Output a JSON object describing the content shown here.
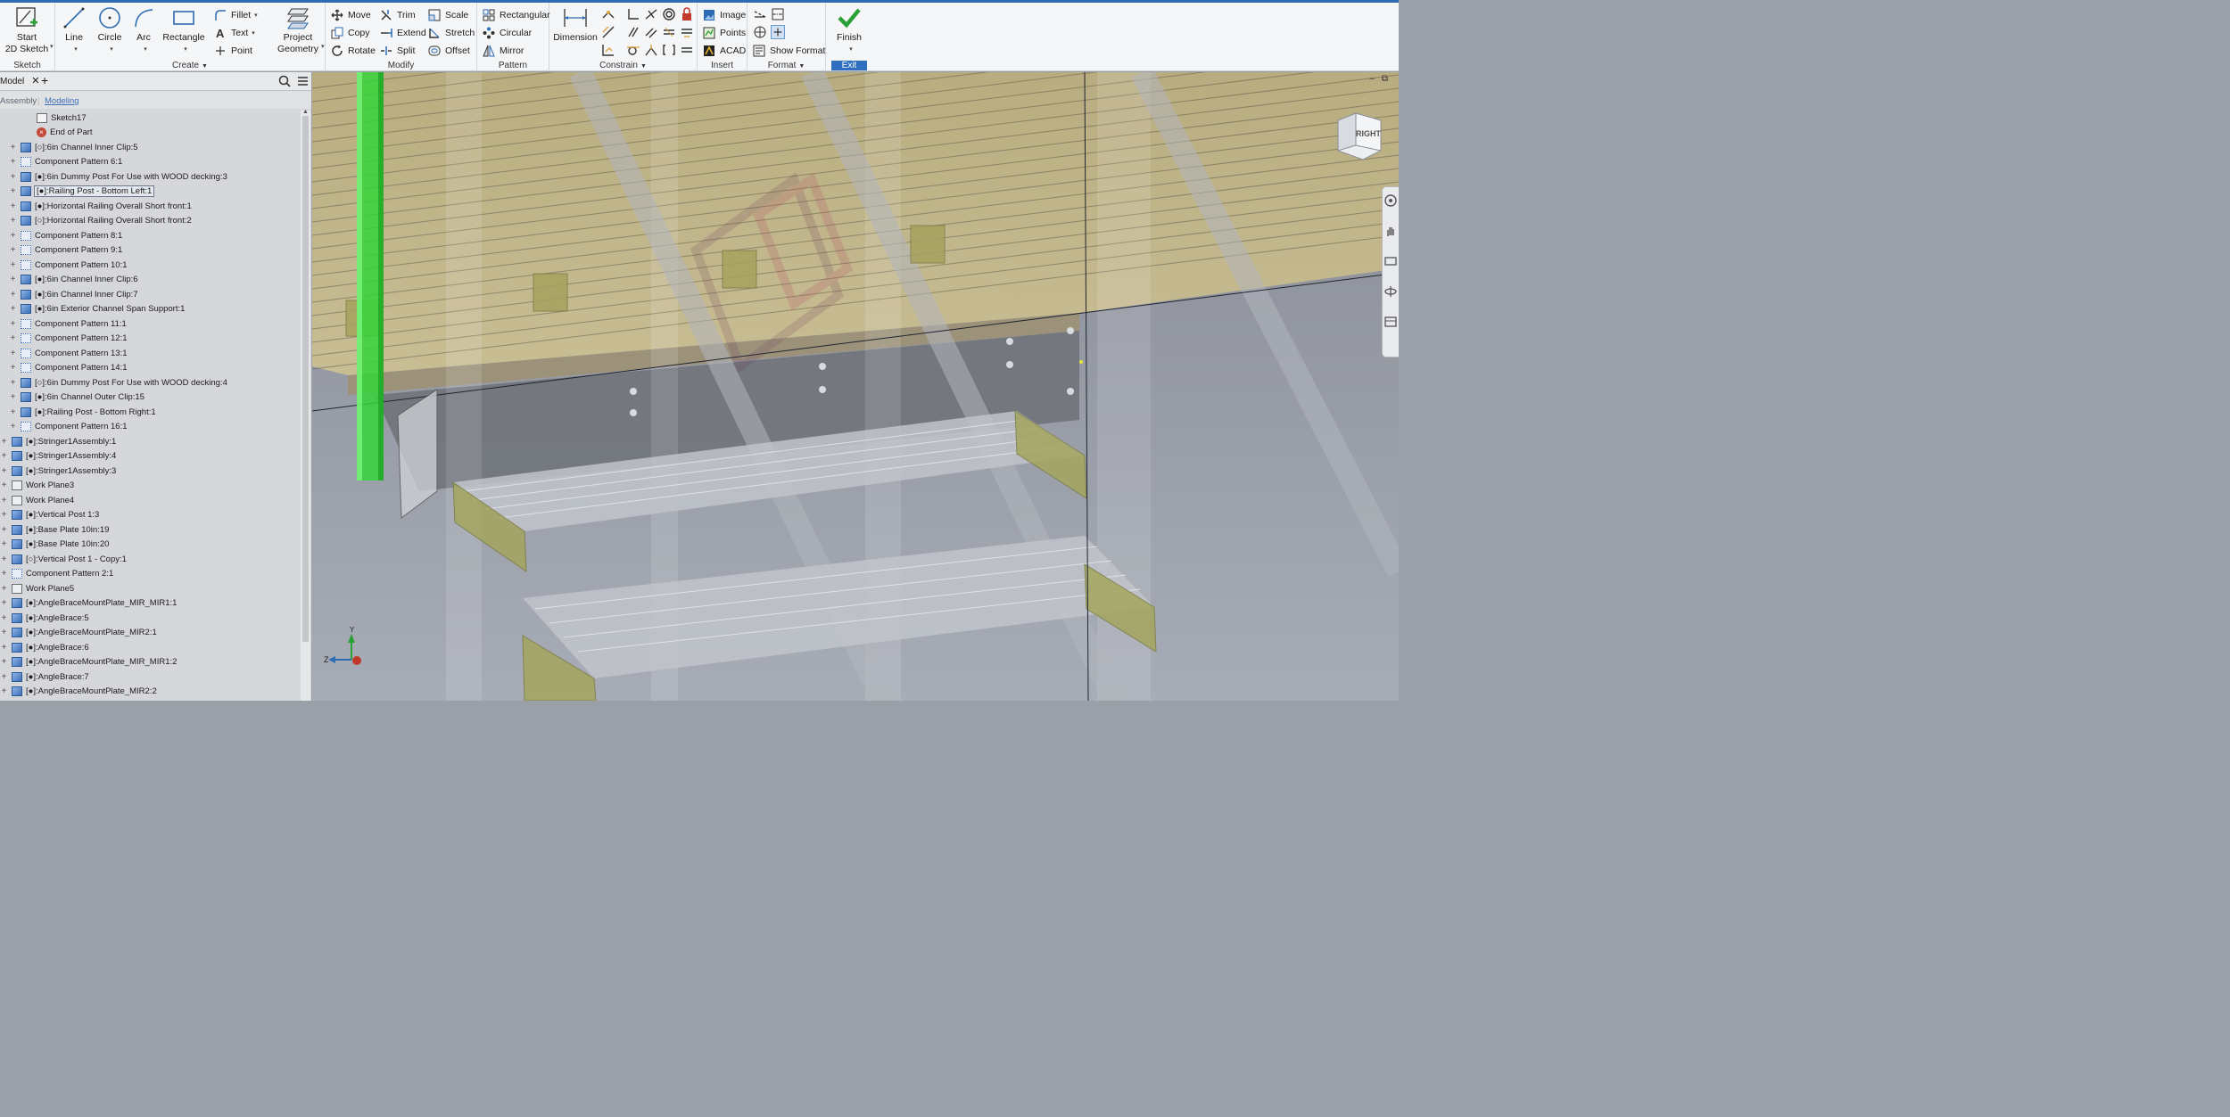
{
  "ribbon": {
    "sketch_panel": {
      "label": "Sketch",
      "start_2d_sketch": "Start\n2D Sketch"
    },
    "create_panel": {
      "label": "Create",
      "line": "Line",
      "circle": "Circle",
      "arc": "Arc",
      "rectangle": "Rectangle",
      "fillet": "Fillet",
      "text": "Text",
      "point": "Point",
      "project_geometry": "Project\nGeometry"
    },
    "modify_panel": {
      "label": "Modify",
      "move": "Move",
      "trim": "Trim",
      "scale": "Scale",
      "copy": "Copy",
      "extend": "Extend",
      "stretch": "Stretch",
      "rotate": "Rotate",
      "split": "Split",
      "offset": "Offset"
    },
    "pattern_panel": {
      "label": "Pattern",
      "rectangular": "Rectangular",
      "circular": "Circular",
      "mirror": "Mirror"
    },
    "constrain_panel": {
      "label": "Constrain",
      "dimension": "Dimension"
    },
    "insert_panel": {
      "label": "Insert",
      "image": "Image",
      "points": "Points",
      "acad": "ACAD"
    },
    "format_panel": {
      "label": "Format",
      "show_format": "Show Format"
    },
    "exit_panel": {
      "label": "Exit",
      "finish": "Finish"
    }
  },
  "browser": {
    "tab": "Model",
    "add_tab": "+",
    "sub_tabs": [
      "Assembly",
      "Modeling"
    ],
    "items": [
      {
        "label": "Sketch17",
        "icon": "sketch"
      },
      {
        "label": "End of Part",
        "icon": "end-of-part"
      },
      {
        "label": "[○]:6in Channel Inner Clip:5",
        "icon": "part"
      },
      {
        "label": "Component Pattern 6:1",
        "icon": "pattern"
      },
      {
        "label": "[●]:6in Dummy Post For Use with WOOD decking:3",
        "icon": "part"
      },
      {
        "label": "[●]:Railing Post - Bottom Left:1",
        "icon": "part",
        "selected": true
      },
      {
        "label": "[●]:Horizontal Railing Overall Short front:1",
        "icon": "part"
      },
      {
        "label": "[○]:Horizontal Railing Overall Short front:2",
        "icon": "part"
      },
      {
        "label": "Component Pattern 8:1",
        "icon": "pattern"
      },
      {
        "label": "Component Pattern 9:1",
        "icon": "pattern"
      },
      {
        "label": "Component Pattern 10:1",
        "icon": "pattern"
      },
      {
        "label": "[●]:6in Channel Inner Clip:6",
        "icon": "part"
      },
      {
        "label": "[●]:6in Channel Inner Clip:7",
        "icon": "part"
      },
      {
        "label": "[●]:6in Exterior Channel Span Support:1",
        "icon": "part"
      },
      {
        "label": "Component Pattern 11:1",
        "icon": "pattern"
      },
      {
        "label": "Component Pattern 12:1",
        "icon": "pattern"
      },
      {
        "label": "Component Pattern 13:1",
        "icon": "pattern"
      },
      {
        "label": "Component Pattern 14:1",
        "icon": "pattern"
      },
      {
        "label": "[○]:6in Dummy Post For Use with WOOD decking:4",
        "icon": "part"
      },
      {
        "label": "[●]:6in Channel Outer Clip:15",
        "icon": "part"
      },
      {
        "label": "[●]:Railing Post - Bottom Right:1",
        "icon": "part"
      },
      {
        "label": "Component Pattern 16:1",
        "icon": "pattern"
      },
      {
        "label": "[●]:Stringer1Assembly:1",
        "icon": "part"
      },
      {
        "label": "[●]:Stringer1Assembly:4",
        "icon": "part"
      },
      {
        "label": "[●]:Stringer1Assembly:3",
        "icon": "part"
      },
      {
        "label": "Work Plane3",
        "icon": "plane"
      },
      {
        "label": "Work Plane4",
        "icon": "plane"
      },
      {
        "label": "[●]:Vertical Post 1:3",
        "icon": "part"
      },
      {
        "label": "[●]:Base Plate 10in:19",
        "icon": "part"
      },
      {
        "label": "[●]:Base Plate 10in:20",
        "icon": "part"
      },
      {
        "label": "[○]:Vertical Post 1 - Copy:1",
        "icon": "part"
      },
      {
        "label": "Component Pattern 2:1",
        "icon": "pattern"
      },
      {
        "label": "Work Plane5",
        "icon": "plane"
      },
      {
        "label": "[●]:AngleBraceMountPlate_MIR_MIR1:1",
        "icon": "part"
      },
      {
        "label": "[●]:AngleBrace:5",
        "icon": "part"
      },
      {
        "label": "[●]:AngleBraceMountPlate_MIR2:1",
        "icon": "part"
      },
      {
        "label": "[●]:AngleBrace:6",
        "icon": "part"
      },
      {
        "label": "[●]:AngleBraceMountPlate_MIR_MIR1:2",
        "icon": "part"
      },
      {
        "label": "[●]:AngleBrace:7",
        "icon": "part"
      },
      {
        "label": "[●]:AngleBraceMountPlate_MIR2:2",
        "icon": "part"
      }
    ]
  },
  "viewport": {
    "view_cube_face": "RIGHT",
    "axis_labels": {
      "y": "Y",
      "z": "Z"
    },
    "colors": {
      "highlight": "#35d43a",
      "decking": "#b9a878",
      "steel": "#8e939c",
      "pad": "#9fa05a"
    }
  }
}
